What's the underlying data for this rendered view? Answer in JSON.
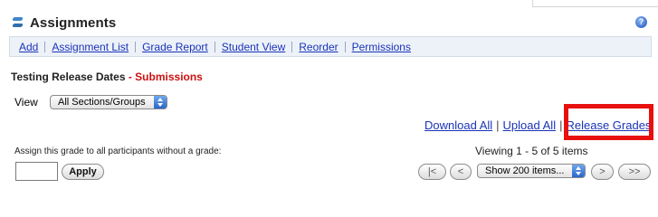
{
  "header": {
    "title": "Assignments",
    "tool_icon": "assignments-tool-icon",
    "help_icon": "help-icon",
    "help_glyph": "?"
  },
  "nav": {
    "items": [
      {
        "label": "Add"
      },
      {
        "label": "Assignment List"
      },
      {
        "label": "Grade Report"
      },
      {
        "label": "Student View"
      },
      {
        "label": "Reorder"
      },
      {
        "label": "Permissions"
      }
    ]
  },
  "page": {
    "assignment_name": "Testing Release Dates",
    "separator": " - ",
    "section": "Submissions",
    "section_color": "#cc1111"
  },
  "view": {
    "label": "View",
    "selected": "All Sections/Groups"
  },
  "actions": {
    "download_all": "Download All",
    "upload_all": "Upload All",
    "release_grades": "Release Grades",
    "separator": "|",
    "highlight_color": "#e8100f"
  },
  "grade_assign": {
    "label": "Assign this grade to all participants without a grade:",
    "input_value": "",
    "apply_label": "Apply"
  },
  "pagination": {
    "viewing_text": "Viewing 1 - 5 of 5 items",
    "first_label": "|<",
    "prev_label": "<",
    "page_size_selected": "Show 200 items...",
    "next_label": ">",
    "last_label": ">>"
  },
  "colors": {
    "link": "#1a33b8",
    "nav_background": "#edf2f9"
  }
}
